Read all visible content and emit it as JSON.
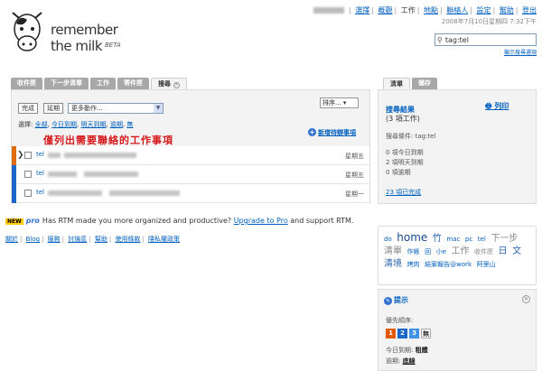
{
  "app": {
    "logo_line1": "remember",
    "logo_line2": "the milk",
    "logo_beta": "BETA"
  },
  "topnav": {
    "items": [
      "選擇",
      "概觀",
      "工作",
      "地點",
      "聯絡人",
      "設定",
      "幫助",
      "登出"
    ],
    "current": "工作",
    "datetime": "2008年7月10日星期四 7:32下午"
  },
  "search": {
    "value": "tag:tel",
    "tip": "顯示搜尋選項"
  },
  "tabs": [
    "收件匣",
    "下一步清單",
    "工作",
    "寄件匣",
    "搜尋"
  ],
  "toolbar": {
    "complete": "完成",
    "postpone": "延期",
    "more_actions": "更多動作...",
    "sort": "排序..."
  },
  "select_row": {
    "label": "選擇:",
    "options": [
      "全部",
      "今日到期",
      "明天到期",
      "逾期",
      "無"
    ]
  },
  "annotation": "僅列出需要聯絡的工作事項",
  "add_task": "新增待辦事項",
  "tasks": [
    {
      "tag": "tel",
      "due": "星期五",
      "priority_color": "#e06b00",
      "arrow": "❯"
    },
    {
      "tag": "tel",
      "due": "星期五",
      "priority_color": "#1b66c9",
      "arrow": ""
    },
    {
      "tag": "tel",
      "due": "星期一",
      "priority_color": "#1b66c9",
      "arrow": ""
    }
  ],
  "promo": {
    "new": "NEW",
    "pro": "pro",
    "text_before": "Has RTM made you more organized and productive?",
    "link": "Upgrade to Pro",
    "text_after": "and support RTM."
  },
  "footer": [
    "關於",
    "Blog",
    "服務",
    "討論區",
    "幫助",
    "使用條款",
    "隱私權政策"
  ],
  "right_tabs": [
    "清單",
    "儲存"
  ],
  "list_info": {
    "title": "搜尋結果",
    "count": "(3 項工作)",
    "print": "列印",
    "condition": "搜尋條件: tag:tel",
    "stats": [
      "0 項今日到期",
      "2 項明天到期",
      "0 項逾期"
    ],
    "completed": "23 項已完成"
  },
  "tag_cloud": [
    {
      "t": "do",
      "s": "sml"
    },
    {
      "t": "home",
      "s": "big"
    },
    {
      "t": "竹",
      "s": "med"
    },
    {
      "t": "mac",
      "s": "sml"
    },
    {
      "t": "pc",
      "s": "sml"
    },
    {
      "t": "tel",
      "s": "sml"
    },
    {
      "t": "下一步",
      "s": "med grey"
    },
    {
      "t": "清單",
      "s": "med grey"
    },
    {
      "t": "作帳",
      "s": "sml"
    },
    {
      "t": "回",
      "s": "sml"
    },
    {
      "t": "小e",
      "s": "sml"
    },
    {
      "t": "工作",
      "s": "med grey"
    },
    {
      "t": "收件匣",
      "s": "sml grey"
    },
    {
      "t": "日",
      "s": "med"
    },
    {
      "t": "文",
      "s": "med"
    },
    {
      "t": "清境",
      "s": "med"
    },
    {
      "t": "烤肉",
      "s": "sml"
    },
    {
      "t": "結案報告@work",
      "s": "sml"
    },
    {
      "t": "阿里山",
      "s": "sml"
    }
  ],
  "tips": {
    "title": "提示",
    "order_label": "優先順序:",
    "priorities": [
      {
        "label": "1",
        "color": "#e05a00"
      },
      {
        "label": "2",
        "color": "#1b66c9"
      },
      {
        "label": "3",
        "color": "#3f93e6"
      },
      {
        "label": "無",
        "color": "#ffffff"
      }
    ],
    "today_label": "今日到期:",
    "today_style": "粗體",
    "overdue_label": "逾期:",
    "overdue_style": "底線"
  }
}
